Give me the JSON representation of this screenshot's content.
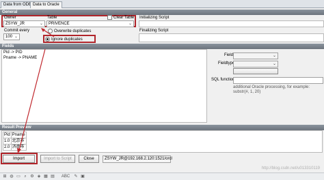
{
  "tabs": [
    {
      "label": "Data from ODBC",
      "active": false
    },
    {
      "label": "Data to Oracle",
      "active": true
    }
  ],
  "general": {
    "header": "General",
    "owner_label": "Owner",
    "owner_value": "ZSYW_JR",
    "table_label": "Table",
    "table_value": "PRIVENCE",
    "clear_table_label": "Clear Table",
    "initializing_script_label": "Initializing Script",
    "commit_every_label": "Commit every",
    "commit_every_value": "100",
    "overwrite_label": "Overwrite duplicates",
    "ignore_label": "Ignore duplicates",
    "finalizing_script_label": "Finalizing Script"
  },
  "fields": {
    "header": "Fields",
    "rows": [
      {
        "src": "Pid",
        "arrow": "->",
        "dst": "PID"
      },
      {
        "src": "Pname",
        "arrow": "->",
        "dst": "PNAME"
      }
    ],
    "field_label": "Field",
    "fieldtype_label": "Fieldtype",
    "sql_function_label": "SQL function",
    "sql_hint": "additional Oracle processing, for example: substr(#, 1, 20)"
  },
  "result": {
    "header": "Result Preview",
    "columns": [
      "Pid",
      "Pname"
    ],
    "rows": [
      [
        "1.0",
        "北京市"
      ],
      [
        "2.0",
        "济南市"
      ]
    ]
  },
  "buttons": {
    "import": "Import",
    "import_to_script": "Import to Script",
    "close": "Close"
  },
  "connection": "ZSYW_JR@192.168.2.120:1521/orcl",
  "watermark": "http://blog.csdn.net/u013310119",
  "colors": {
    "annotation_red": "#b0242a",
    "header_gray": "#7a828b"
  }
}
